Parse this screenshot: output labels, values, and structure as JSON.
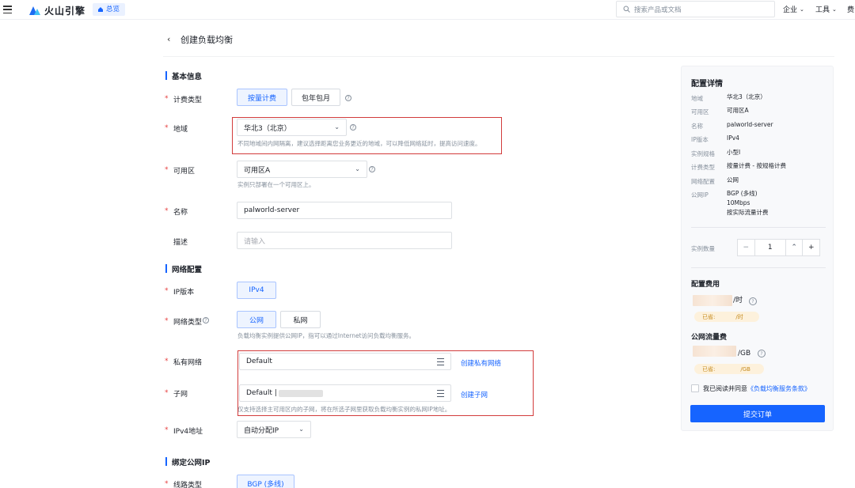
{
  "topbar": {
    "brand": "火山引擎",
    "overview": "总览",
    "search_placeholder": "搜索产品或文档",
    "nav_enterprise": "企业",
    "nav_tools": "工具",
    "nav_fee": "费"
  },
  "page": {
    "title": "创建负载均衡"
  },
  "basic": {
    "section": "基本信息",
    "billing_label": "计费类型",
    "billing_options": [
      "按量计费",
      "包年包月"
    ],
    "region_label": "地域",
    "region_value": "华北3（北京）",
    "region_hint": "不同地域间内网隔离，建议选择距离您业务更近的地域，可以降低网络延时，提高访问速度。",
    "zone_label": "可用区",
    "zone_value": "可用区A",
    "zone_hint": "实例只部署在一个可用区上。",
    "name_label": "名称",
    "name_value": "palworld-server",
    "desc_label": "描述",
    "desc_placeholder": "请输入"
  },
  "network": {
    "section": "网络配置",
    "ip_label": "IP版本",
    "ip_value": "IPv4",
    "nettype_label": "网络类型",
    "nettype_options": [
      "公网",
      "私网"
    ],
    "nettype_hint": "负载均衡实例提供公网IP，指可以通过Internet访问负载均衡服务。",
    "vpc_label": "私有网络",
    "vpc_value": "Default",
    "vpc_link": "创建私有网络",
    "subnet_label": "子网",
    "subnet_value": "Default |",
    "subnet_link": "创建子网",
    "subnet_hint": "仅支持选择主可用区内的子网，将在所选子网里获取负载均衡实例的私网IP地址。",
    "ipv4_label": "IPv4地址",
    "ipv4_value": "自动分配IP"
  },
  "eip": {
    "section": "绑定公网IP",
    "line_label": "线路类型",
    "line_value": "BGP (多线)"
  },
  "summary": {
    "title": "配置详情",
    "rows": [
      {
        "k": "地域",
        "v": "华北3（北京）"
      },
      {
        "k": "可用区",
        "v": "可用区A"
      },
      {
        "k": "名称",
        "v": "palworld-server"
      },
      {
        "k": "IP版本",
        "v": "IPv4"
      },
      {
        "k": "实例规格",
        "v": "小型I"
      },
      {
        "k": "计费类型",
        "v": "按量计费 - 按规格计费"
      },
      {
        "k": "网络配置",
        "v": "公网"
      },
      {
        "k": "公网IP",
        "v": "BGP (多线)"
      }
    ],
    "eip_line2": "10Mbps",
    "eip_line3": "按实际流量计费",
    "qty_label": "实例数量",
    "qty_value": "1",
    "fee_title": "配置费用",
    "fee_unit": "/时",
    "saved_label": "已省:",
    "saved_unit_hour": "/时",
    "traffic_title": "公网流量费",
    "traffic_unit": "/GB",
    "saved_unit_gb": "/GB",
    "agree_prefix": "我已阅读并同意",
    "agree_link": "《负载均衡服务条款》",
    "submit": "提交订单"
  }
}
